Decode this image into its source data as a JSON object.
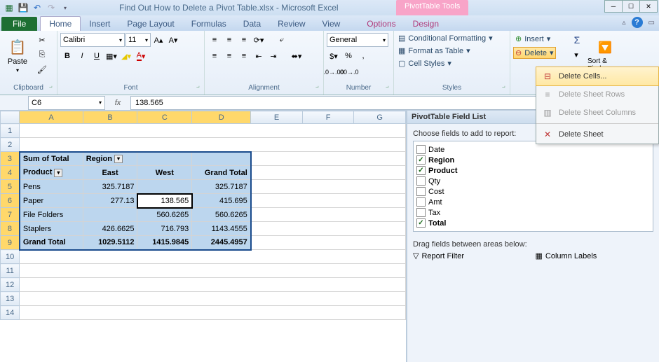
{
  "title": "Find Out How to Delete a Pivot Table.xlsx - Microsoft Excel",
  "ptt_label": "PivotTable Tools",
  "tabs": {
    "file": "File",
    "home": "Home",
    "insert": "Insert",
    "page_layout": "Page Layout",
    "formulas": "Formulas",
    "data": "Data",
    "review": "Review",
    "view": "View",
    "options": "Options",
    "design": "Design"
  },
  "ribbon": {
    "clipboard": {
      "paste": "Paste",
      "label": "Clipboard"
    },
    "font": {
      "name": "Calibri",
      "size": "11",
      "label": "Font"
    },
    "alignment": {
      "label": "Alignment"
    },
    "number": {
      "format": "General",
      "label": "Number"
    },
    "styles": {
      "cond": "Conditional Formatting",
      "table": "Format as Table",
      "cell": "Cell Styles",
      "label": "Styles"
    },
    "cells": {
      "insert": "Insert",
      "delete": "Delete"
    },
    "editing": {
      "sort": "Sort & Find"
    }
  },
  "delete_menu": {
    "cells": "Delete Cells...",
    "rows": "Delete Sheet Rows",
    "cols": "Delete Sheet Columns",
    "sheet": "Delete Sheet"
  },
  "namebox": "C6",
  "formula": "138.565",
  "columns": [
    "A",
    "B",
    "C",
    "D",
    "E",
    "F",
    "G"
  ],
  "pivot": {
    "sum_of": "Sum of Total",
    "region": "Region",
    "product": "Product",
    "east": "East",
    "west": "West",
    "gt": "Grand Total",
    "rows": [
      {
        "name": "Pens",
        "east": "325.7187",
        "west": "",
        "gt": "325.7187"
      },
      {
        "name": "Paper",
        "east": "277.13",
        "west": "138.565",
        "gt": "415.695"
      },
      {
        "name": "File Folders",
        "east": "",
        "west": "560.6265",
        "gt": "560.6265"
      },
      {
        "name": "Staplers",
        "east": "426.6625",
        "west": "716.793",
        "gt": "1143.4555"
      }
    ],
    "total": {
      "east": "1029.5112",
      "west": "1415.9845",
      "gt": "2445.4957"
    }
  },
  "fieldlist": {
    "title": "PivotTable Field List",
    "choose": "Choose fields to add to report:",
    "fields": [
      {
        "name": "Date",
        "checked": false
      },
      {
        "name": "Region",
        "checked": true
      },
      {
        "name": "Product",
        "checked": true
      },
      {
        "name": "Qty",
        "checked": false
      },
      {
        "name": "Cost",
        "checked": false
      },
      {
        "name": "Amt",
        "checked": false
      },
      {
        "name": "Tax",
        "checked": false
      },
      {
        "name": "Total",
        "checked": true
      }
    ],
    "drag": "Drag fields between areas below:",
    "report_filter": "Report Filter",
    "col_labels": "Column Labels"
  }
}
